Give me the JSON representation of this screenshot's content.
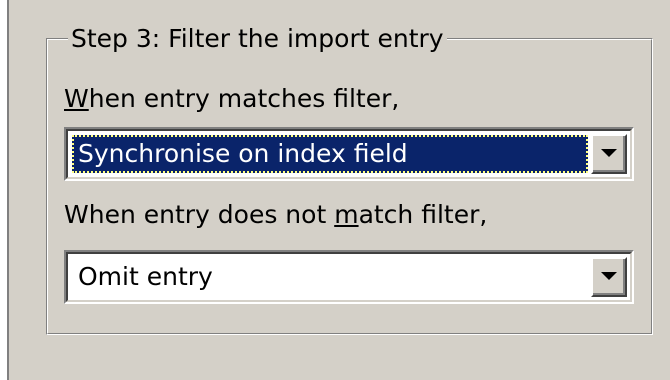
{
  "group": {
    "title": "Step 3:  Filter the import entry"
  },
  "match": {
    "label_prefix_mnemonic": "W",
    "label_rest": "hen entry matches filter,",
    "selected_value": "Synchronise on index field"
  },
  "no_match": {
    "label_before": "When entry does not ",
    "label_mnemonic": "m",
    "label_after": "atch filter,",
    "selected_value": "Omit entry"
  },
  "icons": {
    "dropdown": "chevron-down-icon"
  },
  "colors": {
    "dialog_background": "#d4d0c8",
    "selection_background": "#0a246a",
    "selection_text": "#ffffff"
  }
}
